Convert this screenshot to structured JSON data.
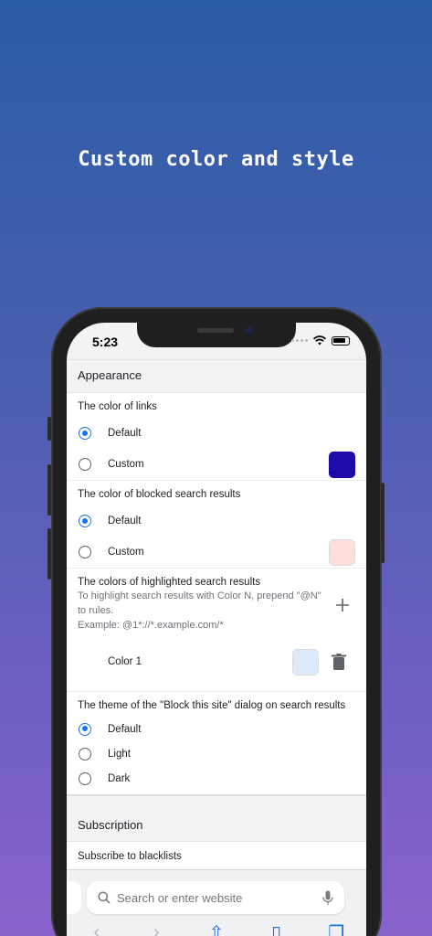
{
  "headline": "Custom color and style",
  "status": {
    "time": "5:23"
  },
  "appearance": {
    "title": "Appearance",
    "links": {
      "title": "The color of links",
      "default_label": "Default",
      "custom_label": "Custom",
      "selected": "default",
      "custom_color": "#1e0aa8"
    },
    "blocked": {
      "title": "The color of blocked search results",
      "default_label": "Default",
      "custom_label": "Custom",
      "selected": "default",
      "custom_color": "#fde0dc"
    },
    "highlight": {
      "title": "The colors of highlighted search results",
      "description_1": "To highlight search results with Color N, prepend \"@N\" to rules.",
      "description_2": "Example: @1*://*.example.com/*",
      "color_label": "Color 1",
      "color_value": "#ddeafb"
    },
    "theme": {
      "title": "The theme of the \"Block this site\" dialog on search results",
      "options": [
        "Default",
        "Light",
        "Dark"
      ],
      "selected": "Default"
    }
  },
  "subscription": {
    "title": "Subscription",
    "subscribe_label": "Subscribe to blacklists"
  },
  "browser": {
    "search_placeholder": "Search or enter website"
  },
  "colors": {
    "accent": "#1a73e8"
  }
}
